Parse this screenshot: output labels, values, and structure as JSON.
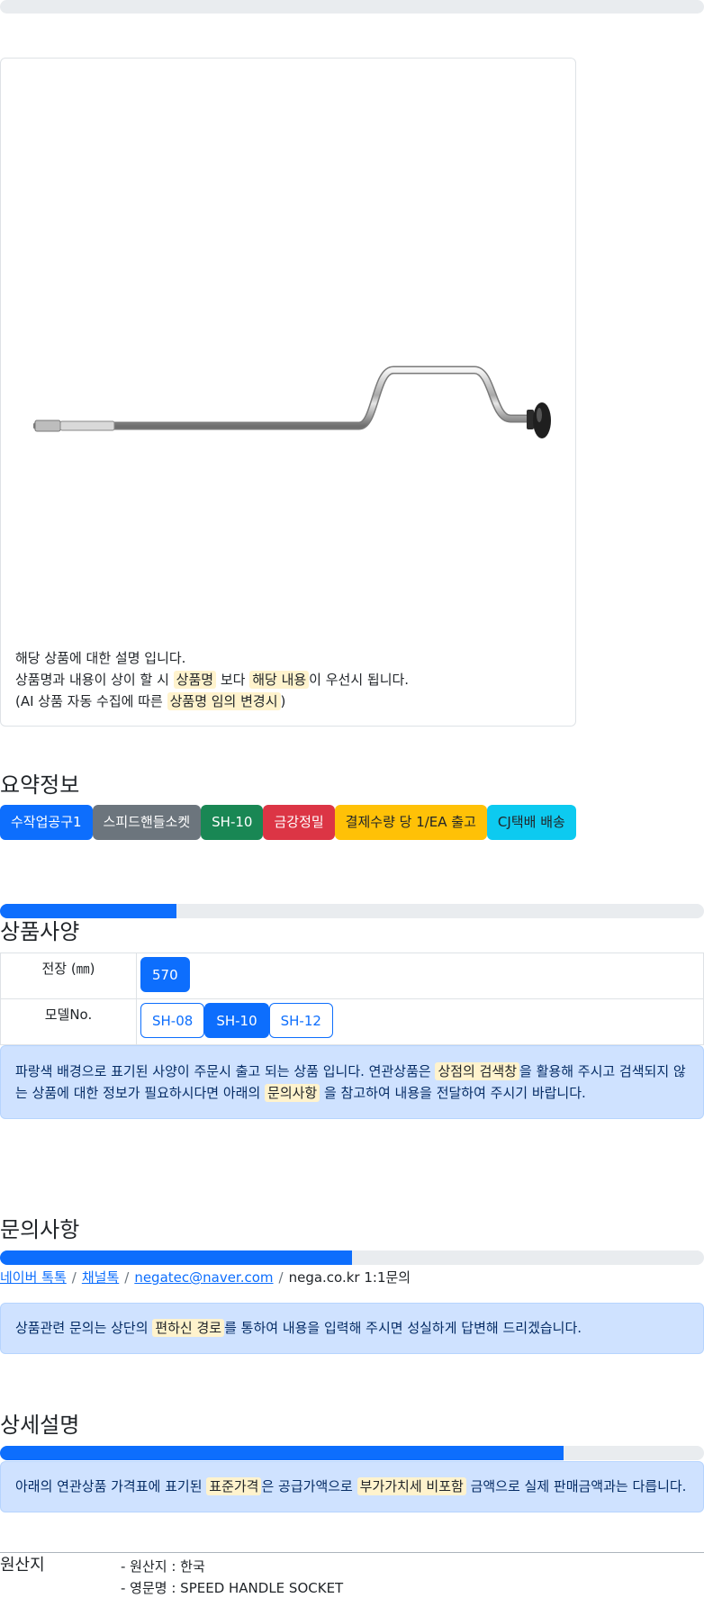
{
  "progress_top": {
    "percent": 0
  },
  "product": {
    "desc_line1": "해당 상품에 대한 설명 입니다.",
    "desc_line2_a": "상품명과 내용이 상이 할 시 ",
    "desc_line2_mark1": "상품명",
    "desc_line2_b": " 보다 ",
    "desc_line2_mark2": "해당 내용",
    "desc_line2_c": "이 우선시 됩니다.",
    "desc_line3_a": "(AI 상품 자동 수집에 따른 ",
    "desc_line3_mark": "상품명 임의 변경시",
    "desc_line3_b": ")"
  },
  "summary": {
    "title": "요약정보",
    "badges": [
      "수작업공구1",
      "스피드핸들소켓",
      "SH-10",
      "금강정밀",
      "결제수량 당 1/EA 출고",
      "CJ택배 배송"
    ],
    "progress_percent": 25
  },
  "specs": {
    "title": "상품사양",
    "rows": [
      {
        "label": "전장 (㎜)",
        "options": [
          "570"
        ]
      },
      {
        "label": "모델No.",
        "options": [
          "SH-08",
          "SH-10",
          "SH-12"
        ]
      }
    ],
    "selected_model": "SH-10",
    "notice_a": "파랑색 배경으로 표기된 사양이 주문시 출고 되는 상품 입니다. 연관상품은 ",
    "notice_mark1": "상점의 검색창",
    "notice_b": "을 활용해 주시고 검색되지 않는 상품에 대한 정보가 필요하시다면 아래의 ",
    "notice_mark2": "문의사항",
    "notice_c": " 을 참고하여 내용을 전달하여 주시기 바랍니다."
  },
  "inquiry": {
    "title": "문의사항",
    "progress_percent": 50,
    "links": [
      "네이버 톡톡",
      "채널톡",
      "negatec@naver.com"
    ],
    "plain": "nega.co.kr 1:1문의",
    "separator": "/",
    "notice_a": "상품관련 문의는 상단의 ",
    "notice_mark": "편하신 경로",
    "notice_b": "를 통하여 내용을 입력해 주시면 성실하게 답변해 드리겠습니다."
  },
  "detail": {
    "title": "상세설명",
    "progress_percent": 80,
    "notice_a": "아래의 연관상품 가격표에 표기된 ",
    "notice_mark1": "표준가격",
    "notice_b": "은 공급가액으로 ",
    "notice_mark2": "부가가치세 비포함",
    "notice_c": " 금액으로 실제 판매금액과는 다릅니다."
  },
  "origin": {
    "label": "원산지",
    "items": [
      "- 원산지 : 한국",
      "- 영문명 : SPEED HANDLE SOCKET"
    ]
  },
  "colors": {
    "primary": "#0d6efd",
    "info_bg": "#cfe2ff",
    "highlight": "#fff3cd"
  }
}
